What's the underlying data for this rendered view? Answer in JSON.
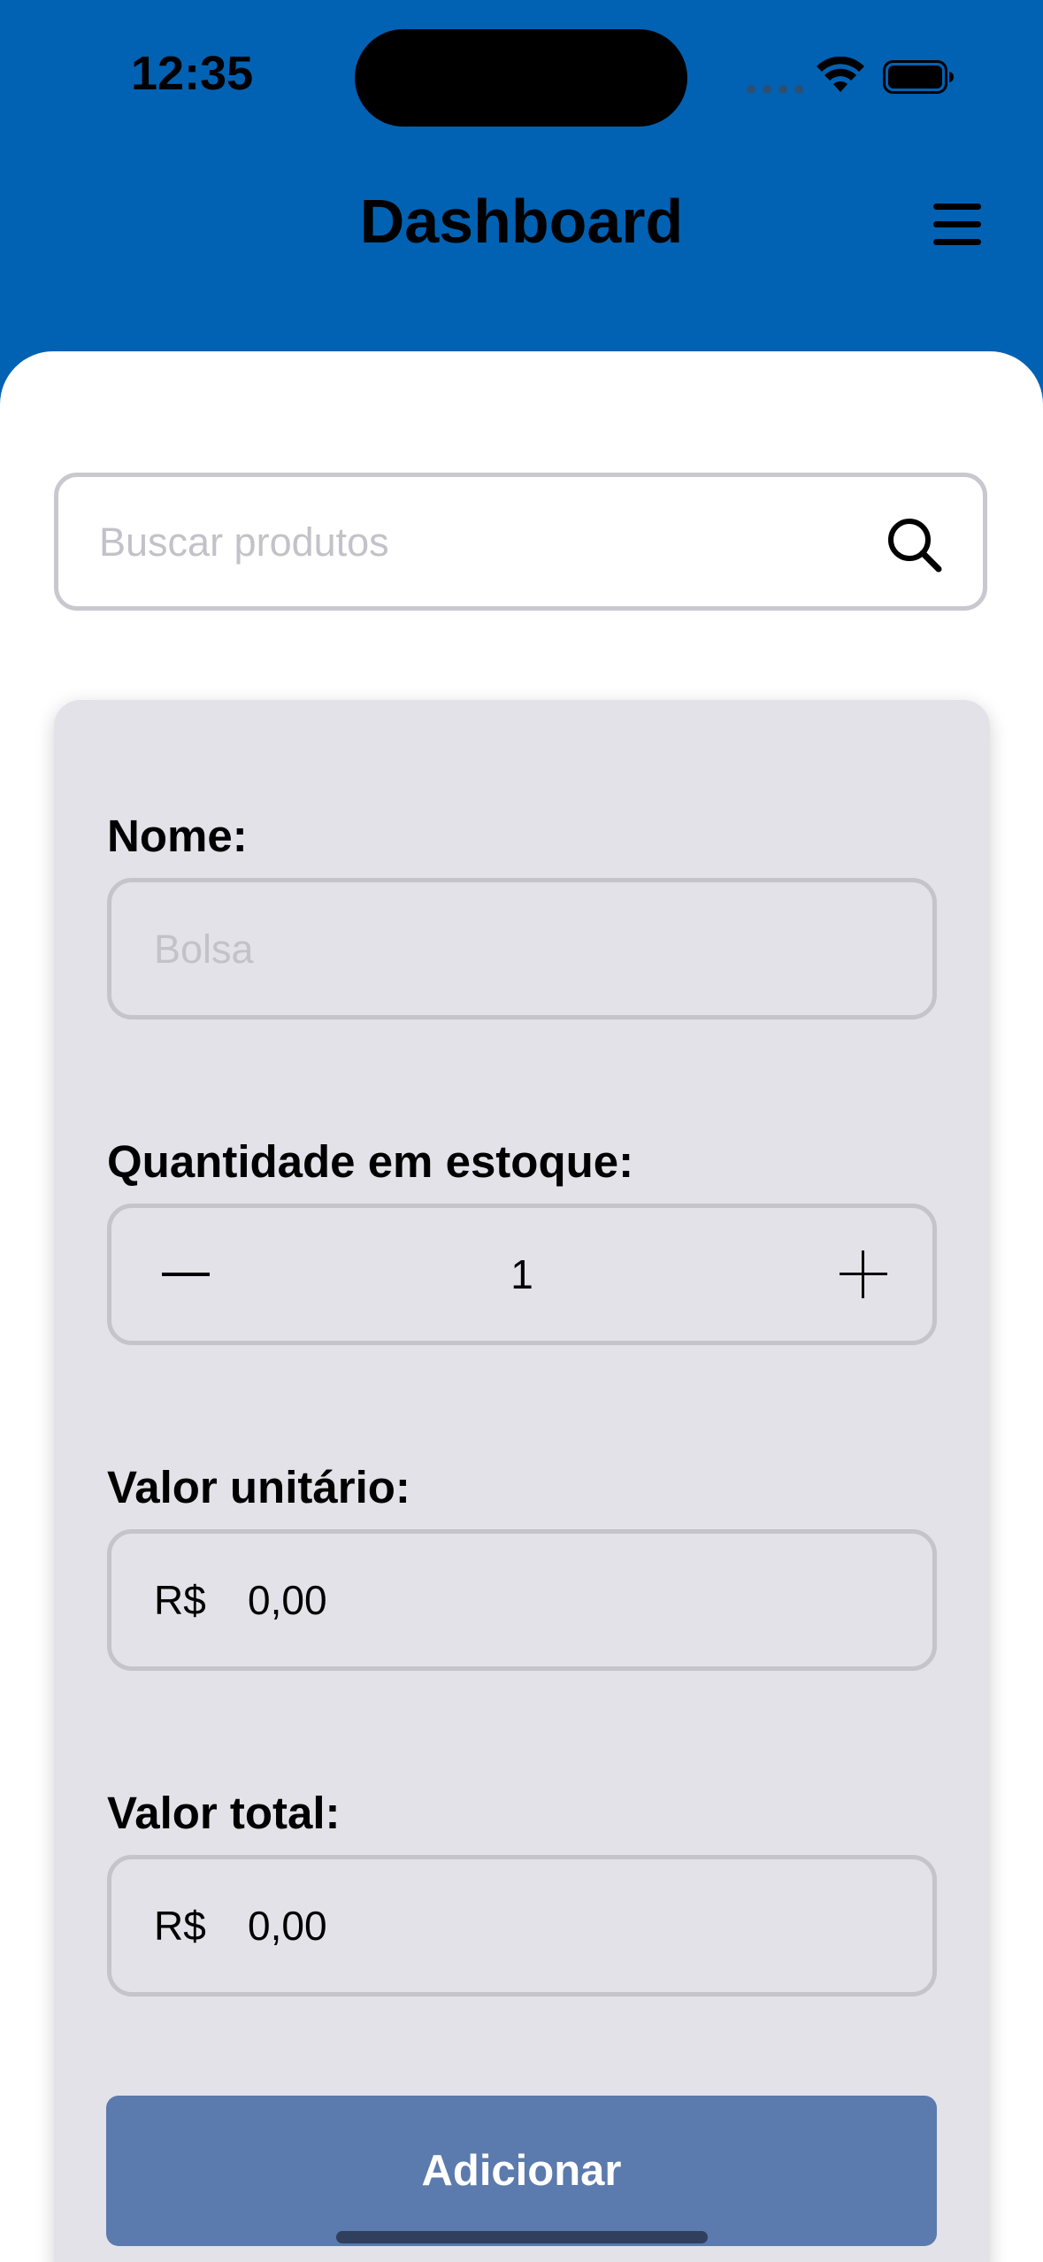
{
  "status_bar": {
    "time": "12:35"
  },
  "header": {
    "title": "Dashboard"
  },
  "search": {
    "placeholder": "Buscar produtos",
    "value": ""
  },
  "form": {
    "name_label": "Nome:",
    "name_placeholder": "Bolsa",
    "name_value": "",
    "quantity_label": "Quantidade em estoque:",
    "quantity_value": "1",
    "unit_price_label": "Valor unitário:",
    "unit_price_prefix": "R$",
    "unit_price_value": "0,00",
    "total_label": "Valor total:",
    "total_prefix": "R$",
    "total_value": "0,00",
    "submit_label": "Adicionar"
  },
  "colors": {
    "header_background": "#0162b3",
    "card_background": "#e3e2e8",
    "button_background": "#5b7aad"
  },
  "icons": [
    "wifi-icon",
    "battery-icon",
    "hamburger-menu-icon",
    "search-icon",
    "minus-icon",
    "plus-icon"
  ]
}
